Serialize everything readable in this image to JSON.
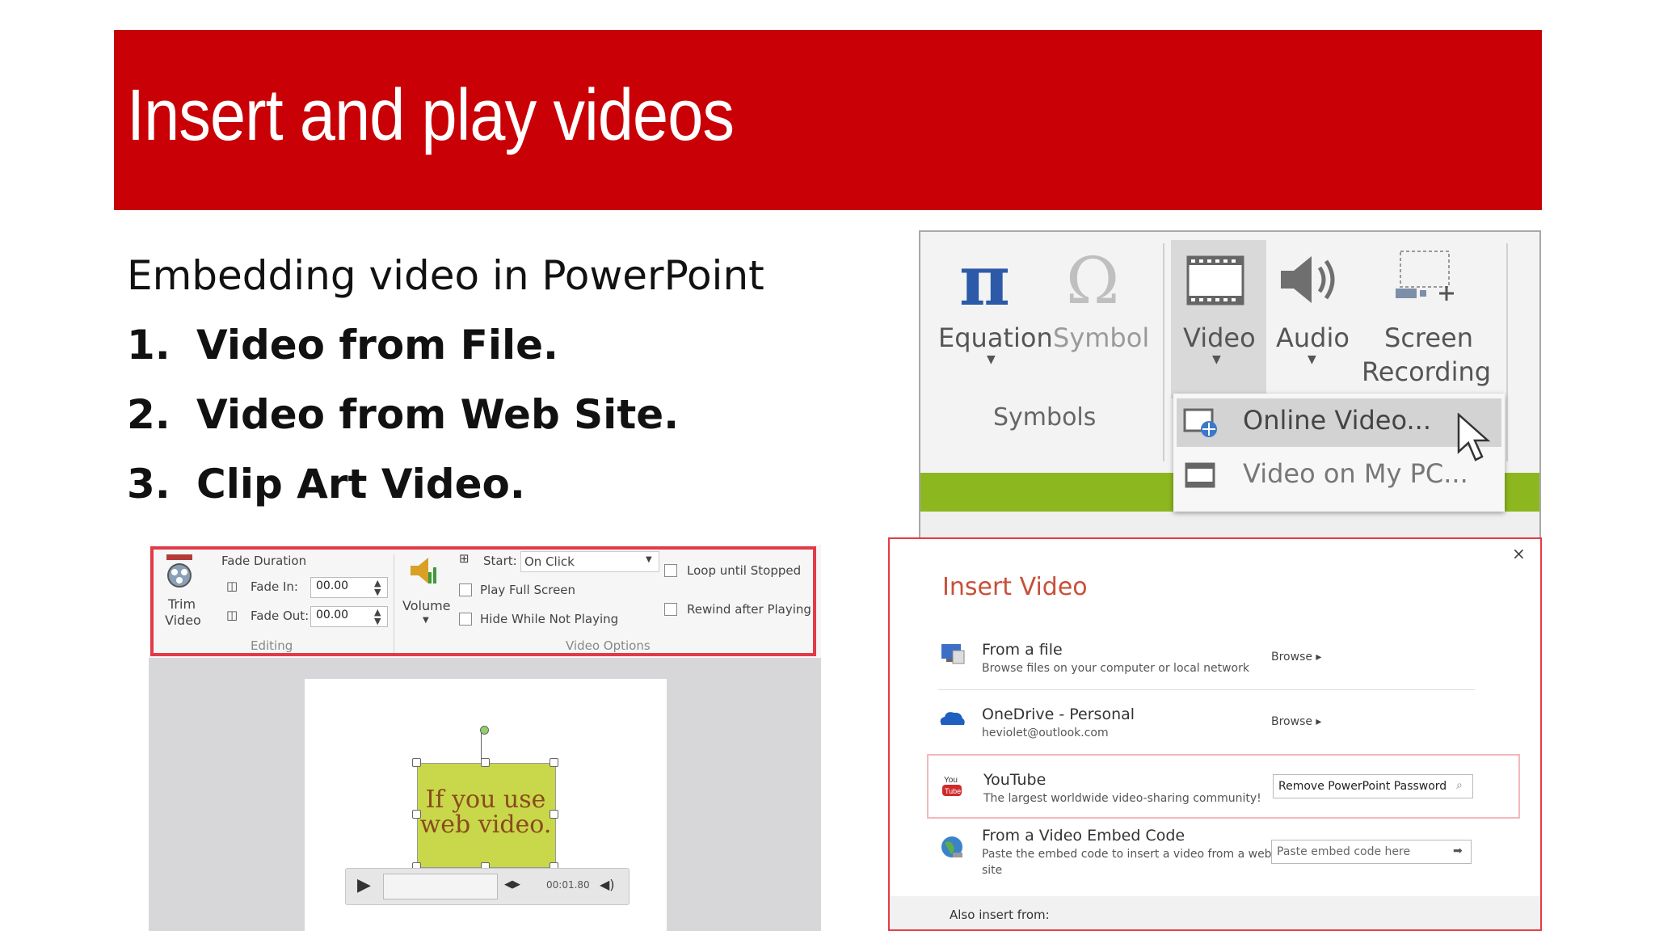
{
  "slide": {
    "title": "Insert and play videos",
    "subtitle": "Embedding video in PowerPoint",
    "list": [
      {
        "num": "1.",
        "label": "Video from File."
      },
      {
        "num": "2.",
        "label": "Video from Web Site."
      },
      {
        "num": "3.",
        "label": "Clip Art Video."
      }
    ]
  },
  "ribbon": {
    "equation": "Equation",
    "symbol": "Symbol",
    "video": "Video",
    "audio": "Audio",
    "screen_recording": [
      "Screen",
      "Recording"
    ],
    "group_symbols": "Symbols",
    "menu": {
      "online_video": "Online Video...",
      "video_on_pc": "Video on My PC..."
    },
    "icons": [
      "pi-icon",
      "omega-icon",
      "film-icon",
      "speaker-icon",
      "screen-record-icon"
    ]
  },
  "video_tools": {
    "trim_label": [
      "Trim",
      "Video"
    ],
    "fade_duration": "Fade Duration",
    "fade_in_label": "Fade In:",
    "fade_in_value": "00.00",
    "fade_out_label": "Fade Out:",
    "fade_out_value": "00.00",
    "group_editing": "Editing",
    "volume": "Volume",
    "start_label": "Start:",
    "start_value": "On Click",
    "play_full_screen": "Play Full Screen",
    "hide_while_not_playing": "Hide While Not Playing",
    "loop_until_stopped": "Loop until Stopped",
    "rewind_after_playing": "Rewind after Playing",
    "group_video_options": "Video Options",
    "video_text": [
      "If you use",
      "web video."
    ],
    "player_time": "00:01.80",
    "accent_outline": "#e33a47"
  },
  "insert_video": {
    "title": "Insert Video",
    "close": "×",
    "rows": [
      {
        "title": "From a file",
        "desc": "Browse files on your computer or local network",
        "action": "Browse"
      },
      {
        "title": "OneDrive - Personal",
        "desc": "heviolet@outlook.com",
        "action": "Browse"
      },
      {
        "title": "YouTube",
        "desc": "The largest worldwide video-sharing community!",
        "field": "Remove PowerPoint Password"
      },
      {
        "title": "From a Video Embed Code",
        "desc": [
          "Paste the embed code to insert a video from a web",
          "site"
        ],
        "field_placeholder": "Paste embed code here"
      }
    ],
    "footer": "Also insert from:",
    "title_color": "#c8503a"
  },
  "colors": {
    "banner": "#c90005",
    "ribbon_green": "#8db71e"
  }
}
